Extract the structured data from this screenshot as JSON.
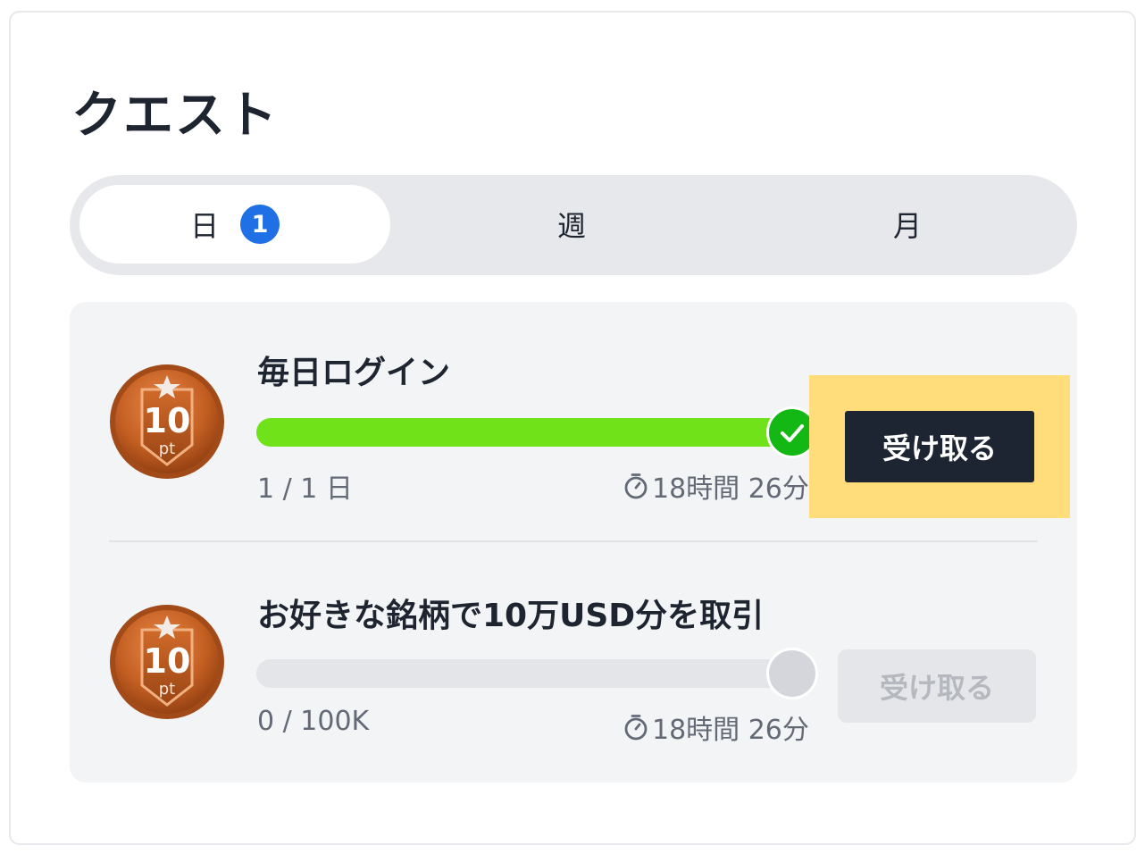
{
  "title": "クエスト",
  "tabs": [
    {
      "label": "日",
      "badge": "1",
      "active": true
    },
    {
      "label": "週",
      "active": false
    },
    {
      "label": "月",
      "active": false
    }
  ],
  "quests": [
    {
      "name": "毎日ログイン",
      "reward": {
        "value": "10",
        "unit": "pt",
        "icon": "bronze-medal-icon"
      },
      "progress_text": "1 / 1 日",
      "progress_fraction": 1.0,
      "status": "complete",
      "time_left": "18時間 26分",
      "claim_label": "受け取る",
      "claim_enabled": true
    },
    {
      "name": "お好きな銘柄で10万USD分を取引",
      "reward": {
        "value": "10",
        "unit": "pt",
        "icon": "bronze-medal-icon"
      },
      "progress_text": "0 / 100K",
      "progress_fraction": 0.0,
      "status": "incomplete",
      "time_left": "18時間 26分",
      "claim_label": "受け取る",
      "claim_enabled": false
    }
  ],
  "colors": {
    "progress_fill": "#6fe21a",
    "complete_check": "#14b814",
    "badge_blue": "#1f6fe5",
    "highlight": "#fedd7a",
    "claim_button": "#1d2432"
  }
}
